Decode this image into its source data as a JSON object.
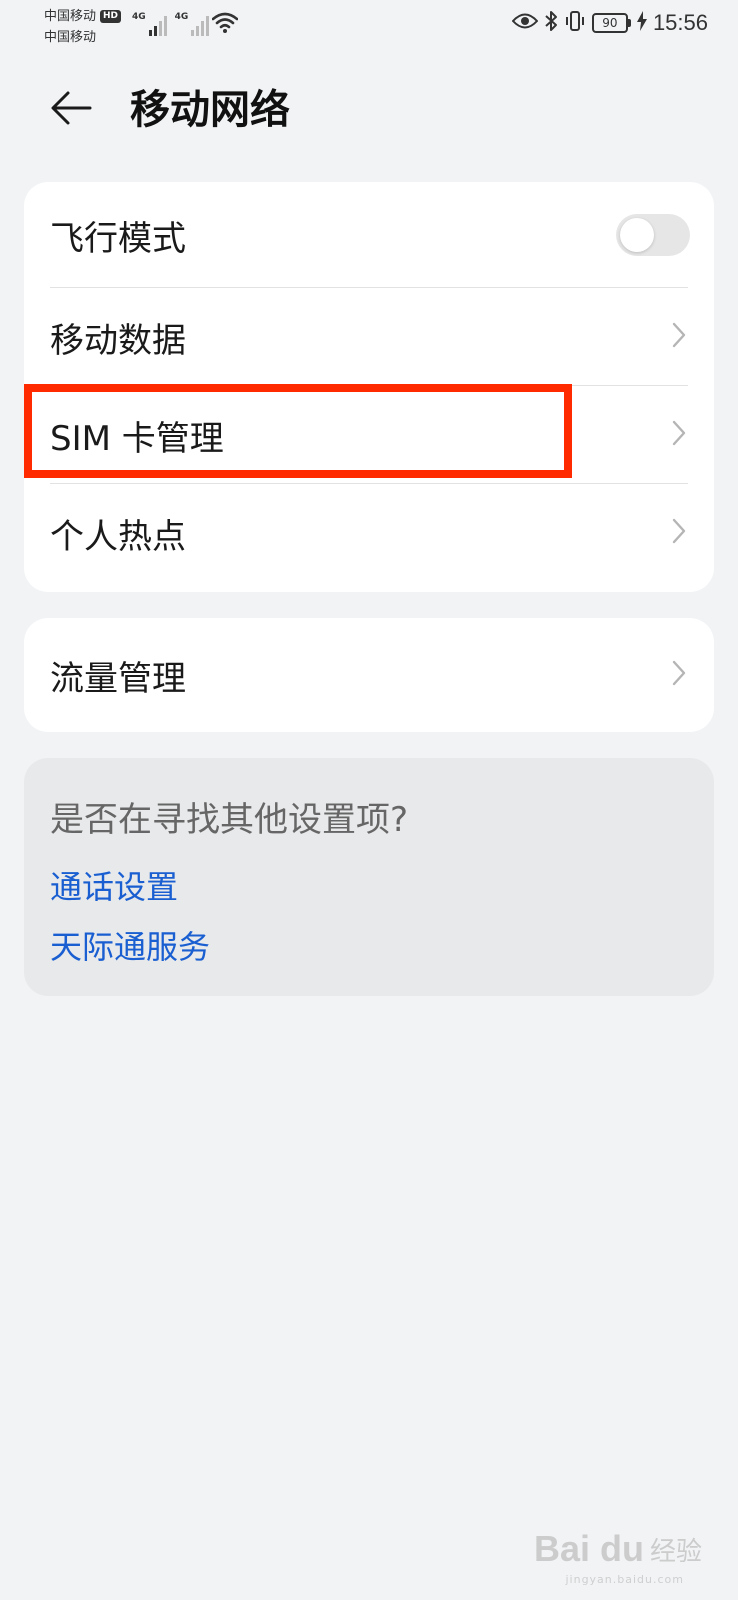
{
  "status_bar": {
    "carrier1": "中国移动",
    "hd_badge": "HD",
    "carrier2": "中国移动",
    "signal1_tag": "4G",
    "signal2_tag": "4G",
    "battery_level": "90",
    "time": "15:56"
  },
  "header": {
    "title": "移动网络"
  },
  "main_card": {
    "items": [
      {
        "label": "飞行模式",
        "toggle_on": false
      },
      {
        "label": "移动数据"
      },
      {
        "label": "SIM 卡管理"
      },
      {
        "label": "个人热点"
      }
    ]
  },
  "data_card": {
    "items": [
      {
        "label": "流量管理"
      }
    ]
  },
  "suggestions": {
    "title": "是否在寻找其他设置项?",
    "links": [
      {
        "label": "通话设置"
      },
      {
        "label": "天际通服务"
      }
    ]
  },
  "colors": {
    "accent_link": "#1a5fd1",
    "highlight": "#ff2a00",
    "background": "#f1f3f5"
  },
  "watermark": {
    "logo": "Bai du",
    "text": "经验",
    "url": "jingyan.baidu.com"
  }
}
